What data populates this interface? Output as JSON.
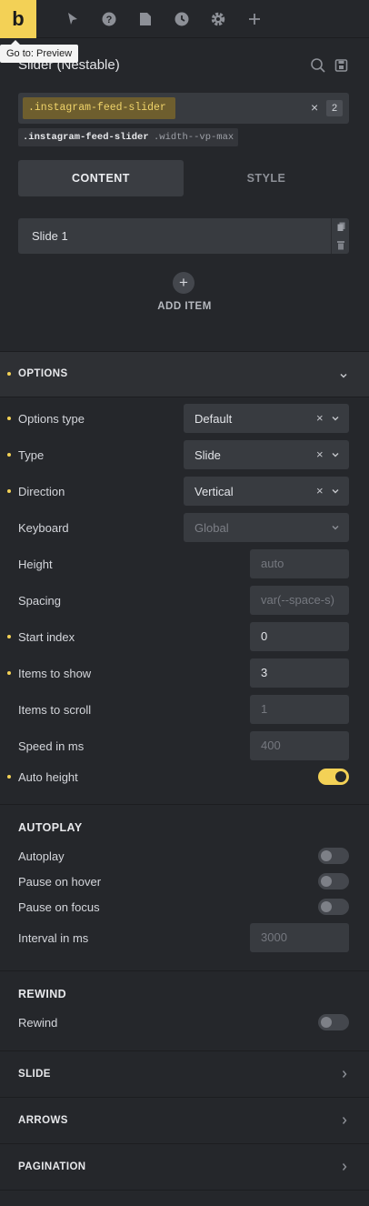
{
  "app": {
    "logo_letter": "b",
    "tooltip": "Go to: Preview",
    "toolbar_icons": [
      "cursor-icon",
      "help-icon",
      "page-icon",
      "history-icon",
      "gear-icon",
      "plus-icon"
    ]
  },
  "panel": {
    "title": "Slider (Nestable)",
    "selector": ".instagram-feed-slider",
    "selector_count": "2",
    "classes": [
      ".instagram-feed-slider",
      ".width--vp-max"
    ],
    "tabs": [
      "CONTENT",
      "STYLE"
    ],
    "active_tab": "CONTENT"
  },
  "items": {
    "list": [
      "Slide 1"
    ],
    "add_label": "ADD ITEM"
  },
  "options": {
    "title": "OPTIONS",
    "rows": [
      {
        "label": "Options type",
        "value": "Default"
      },
      {
        "label": "Type",
        "value": "Slide"
      },
      {
        "label": "Direction",
        "value": "Vertical"
      },
      {
        "label": "Keyboard",
        "value": "Global"
      },
      {
        "label": "Height",
        "value": "auto"
      },
      {
        "label": "Spacing",
        "value": "var(--space-s)"
      },
      {
        "label": "Start index",
        "value": "0"
      },
      {
        "label": "Items to show",
        "value": "3"
      },
      {
        "label": "Items to scroll",
        "value": "1"
      },
      {
        "label": "Speed in ms",
        "value": "400"
      },
      {
        "label": "Auto height",
        "value": "on"
      }
    ]
  },
  "autoplay": {
    "title": "AUTOPLAY",
    "rows": [
      {
        "label": "Autoplay",
        "value": "off"
      },
      {
        "label": "Pause on hover",
        "value": "off"
      },
      {
        "label": "Pause on focus",
        "value": "off"
      },
      {
        "label": "Interval in ms",
        "value": "3000"
      }
    ]
  },
  "rewind": {
    "title": "REWIND",
    "rows": [
      {
        "label": "Rewind",
        "value": "off"
      }
    ]
  },
  "sections": [
    "SLIDE",
    "ARROWS",
    "PAGINATION"
  ],
  "colors": {
    "accent": "#f3d156",
    "background": "#25272b",
    "field": "#383b40"
  }
}
